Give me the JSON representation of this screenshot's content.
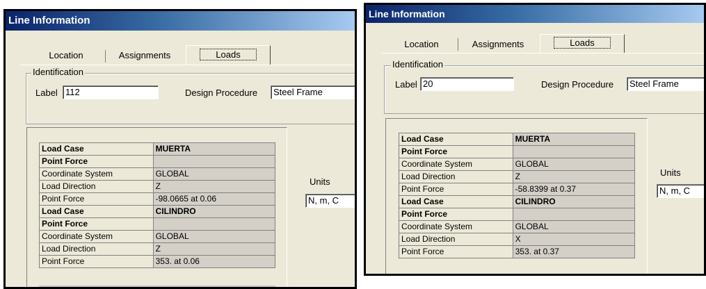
{
  "left": {
    "title": "Line Information",
    "tabs": [
      "Location",
      "Assignments",
      "Loads"
    ],
    "identification_title": "Identification",
    "label_caption": "Label",
    "label_value": "112",
    "design_procedure_caption": "Design Procedure",
    "design_procedure_value": "Steel Frame",
    "units_caption": "Units",
    "units_value": "N, m, C",
    "rows": {
      "r0": [
        "Load Case",
        "MUERTA"
      ],
      "r1": [
        "Point Force",
        ""
      ],
      "r2": [
        "Coordinate System",
        "GLOBAL"
      ],
      "r3": [
        "Load Direction",
        "Z"
      ],
      "r4": [
        "Point Force",
        "-98.0665 at 0.06"
      ],
      "r5": [
        "Load Case",
        "CILINDRO"
      ],
      "r6": [
        "Point Force",
        ""
      ],
      "r7": [
        "Coordinate System",
        "GLOBAL"
      ],
      "r8": [
        "Load Direction",
        "Z"
      ],
      "r9": [
        "Point Force",
        "353. at 0.06"
      ]
    }
  },
  "right": {
    "title": "Line Information",
    "tabs": [
      "Location",
      "Assignments",
      "Loads"
    ],
    "identification_title": "Identification",
    "label_caption": "Label",
    "label_value": "20",
    "design_procedure_caption": "Design Procedure",
    "design_procedure_value": "Steel Frame",
    "units_caption": "Units",
    "units_value": "N, m, C",
    "rows": {
      "r0": [
        "Load Case",
        "MUERTA"
      ],
      "r1": [
        "Point Force",
        ""
      ],
      "r2": [
        "Coordinate System",
        "GLOBAL"
      ],
      "r3": [
        "Load Direction",
        "Z"
      ],
      "r4": [
        "Point Force",
        "-58.8399 at 0.37"
      ],
      "r5": [
        "Load Case",
        "CILINDRO"
      ],
      "r6": [
        "Point Force",
        ""
      ],
      "r7": [
        "Coordinate System",
        "GLOBAL"
      ],
      "r8": [
        "Load Direction",
        "X"
      ],
      "r9": [
        "Point Force",
        "353. at 0.37"
      ]
    }
  }
}
